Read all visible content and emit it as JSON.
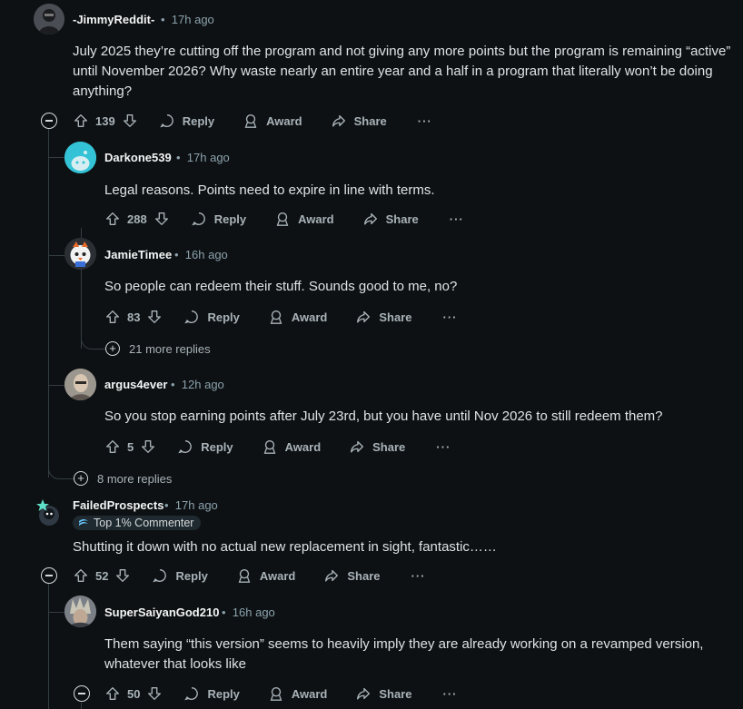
{
  "labels": {
    "reply": "Reply",
    "award": "Award",
    "share": "Share",
    "more": "···",
    "sep": "•"
  },
  "comments": [
    {
      "author": "-JimmyReddit-",
      "time": "17h ago",
      "body": "July 2025 they’re cutting off the program and not giving any more points but the program is remaining “active” until November 2026? Why waste nearly an entire year and a half in a program that literally won’t be doing anything?",
      "score": "139"
    },
    {
      "author": "Darkone539",
      "time": "17h ago",
      "body": "Legal reasons. Points need to expire in line with terms.",
      "score": "288"
    },
    {
      "author": "JamieTimee",
      "time": "16h ago",
      "body": "So people can redeem their stuff. Sounds good to me, no?",
      "score": "83"
    },
    {
      "author": "argus4ever",
      "time": "12h ago",
      "body": "So you stop earning points after July 23rd, but you have until Nov 2026 to still redeem them?",
      "score": "5"
    },
    {
      "author": "FailedProspects",
      "time": "17h ago",
      "flair": "Top 1% Commenter",
      "body": "Shutting it down with no actual new replacement in sight, fantastic……",
      "score": "52"
    },
    {
      "author": "SuperSaiyanGod210",
      "time": "16h ago",
      "body": "Them saying “this version” seems to heavily imply they are already working on a revamped version, whatever that looks like",
      "score": "50"
    }
  ],
  "more_replies": [
    "21 more replies",
    "8 more replies"
  ],
  "colors": {
    "background": "#0e1113",
    "thread_line": "#333d42",
    "meta": "#8ba2ad",
    "avatar_snoo": "#34c3d6"
  }
}
